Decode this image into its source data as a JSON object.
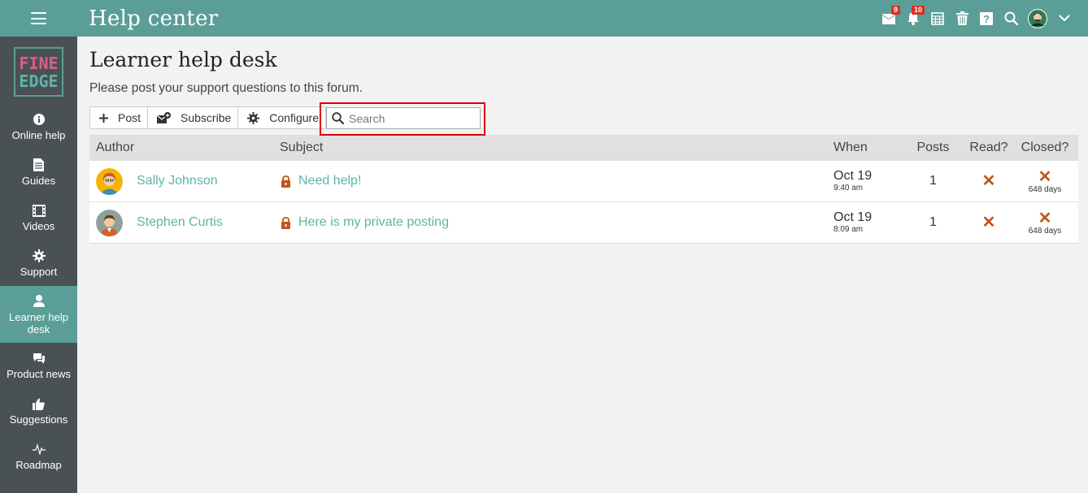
{
  "header": {
    "title": "Help center",
    "icons": [
      {
        "name": "messages-icon",
        "badge": "9"
      },
      {
        "name": "notifications-icon",
        "badge": "10"
      },
      {
        "name": "calendar-icon"
      },
      {
        "name": "trash-icon"
      },
      {
        "name": "help-icon"
      },
      {
        "name": "search-icon"
      },
      {
        "name": "user-avatar"
      },
      {
        "name": "chevron-down-icon"
      }
    ]
  },
  "logo": {
    "line1": "FINE",
    "line2": "EDGE"
  },
  "sidebar": {
    "items": [
      {
        "label": "Online help",
        "icon": "info-icon"
      },
      {
        "label": "Guides",
        "icon": "document-icon"
      },
      {
        "label": "Videos",
        "icon": "film-icon"
      },
      {
        "label": "Support",
        "icon": "gear-icon"
      },
      {
        "label": "Learner help desk",
        "icon": "person-icon",
        "active": true
      },
      {
        "label": "Product news",
        "icon": "chat-icon"
      },
      {
        "label": "Suggestions",
        "icon": "thumbs-up-icon"
      },
      {
        "label": "Roadmap",
        "icon": "pulse-icon"
      }
    ]
  },
  "main": {
    "title": "Learner help desk",
    "description": "Please post your support questions to this forum.",
    "toolbar": {
      "post_label": "Post",
      "subscribe_label": "Subscribe",
      "configure_label": "Configure"
    },
    "search": {
      "placeholder": "Search",
      "value": ""
    },
    "table": {
      "columns": [
        "Author",
        "Subject",
        "When",
        "Posts",
        "Read?",
        "Closed?"
      ],
      "rows": [
        {
          "author": "Sally Johnson",
          "subject": "Need help!",
          "date": "Oct 19",
          "time": "9:40 am",
          "posts": "1",
          "read": "✕",
          "closed": "✕",
          "closed_days": "648 days"
        },
        {
          "author": "Stephen Curtis",
          "subject": "Here is my private posting",
          "date": "Oct 19",
          "time": "8:09 am",
          "posts": "1",
          "read": "✕",
          "closed": "✕",
          "closed_days": "648 days"
        }
      ]
    }
  },
  "colors": {
    "accent": "#5a9e97",
    "sidebar_bg": "#4a5155",
    "link": "#5fb3a8",
    "badge": "#d93025",
    "x_mark": "#c0561d",
    "highlight_frame": "#e00000"
  }
}
